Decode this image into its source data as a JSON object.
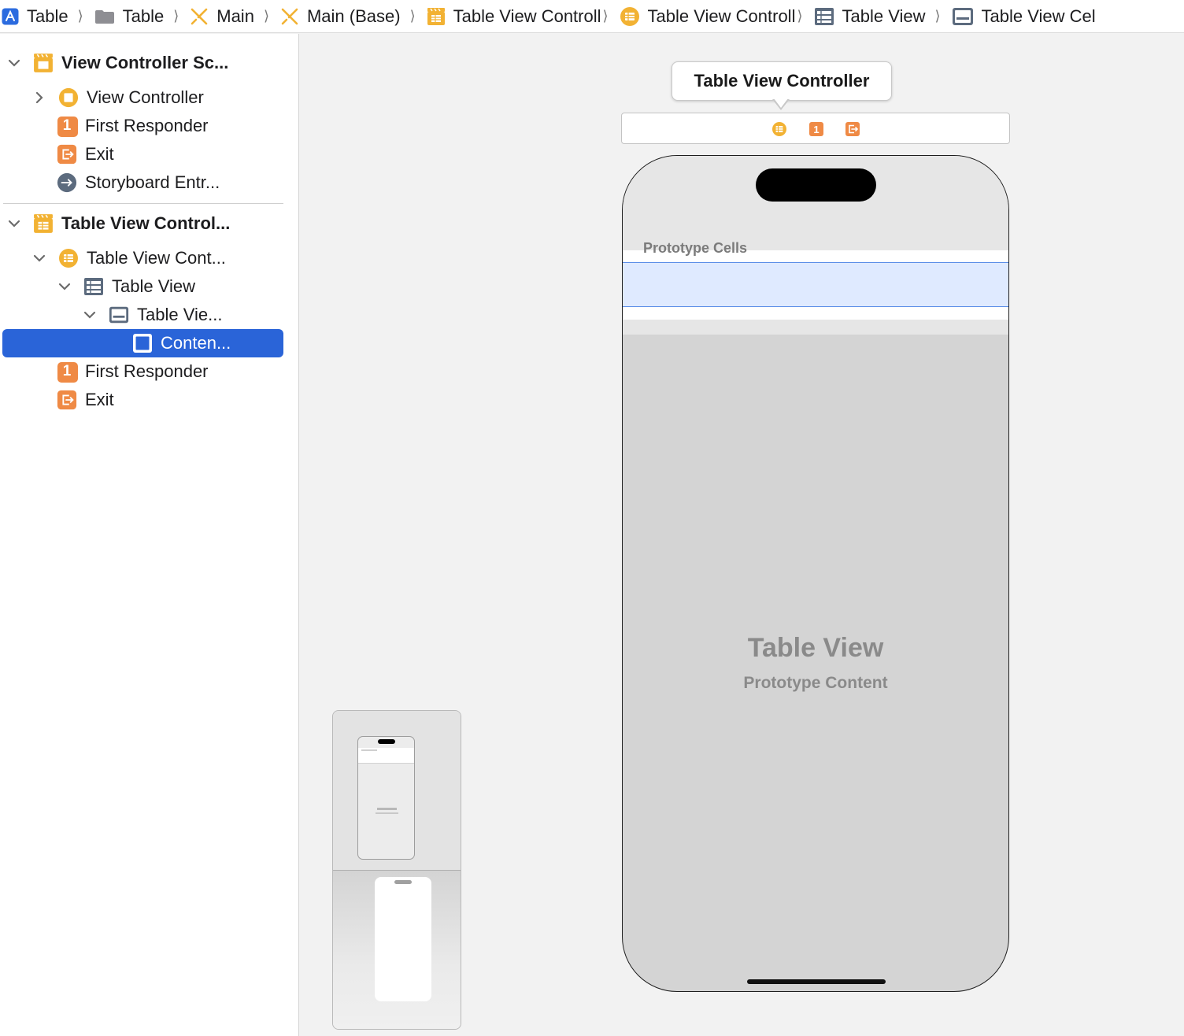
{
  "colors": {
    "selection": "#2a64d8",
    "scene_icon": "#f2b233",
    "responder_icon": "#ef8a45",
    "table_icon": "#5c6b7e",
    "cell_highlight": "#dfeaff"
  },
  "breadcrumb": [
    {
      "icon": "app-icon",
      "label": "Table"
    },
    {
      "icon": "folder-icon",
      "label": "Table"
    },
    {
      "icon": "storyboard-icon",
      "label": "Main"
    },
    {
      "icon": "storyboard-icon",
      "label": "Main (Base)"
    },
    {
      "icon": "scene-icon",
      "label": "Table View Controll"
    },
    {
      "icon": "table-view-controller-icon",
      "label": "Table View Controll"
    },
    {
      "icon": "table-view-icon",
      "label": "Table View"
    },
    {
      "icon": "table-view-cell-icon",
      "label": "Table View Cel"
    }
  ],
  "outline": {
    "scene1": {
      "title": "View Controller Sc...",
      "items": [
        {
          "label": "View Controller"
        },
        {
          "label": "First Responder",
          "badge": "1"
        },
        {
          "label": "Exit"
        },
        {
          "label": "Storyboard Entr..."
        }
      ]
    },
    "scene2": {
      "title": "Table View Control...",
      "items": [
        {
          "label": "Table View Cont..."
        },
        {
          "label": "Table View"
        },
        {
          "label": "Table Vie..."
        },
        {
          "label": "Conten..."
        },
        {
          "label": "First Responder",
          "badge": "1"
        },
        {
          "label": "Exit"
        }
      ]
    }
  },
  "canvas": {
    "scene_title": "Table View Controller",
    "dock_badge": "1",
    "prototype_header": "Prototype Cells",
    "table_view_title": "Table View",
    "table_view_subtitle": "Prototype Content"
  }
}
